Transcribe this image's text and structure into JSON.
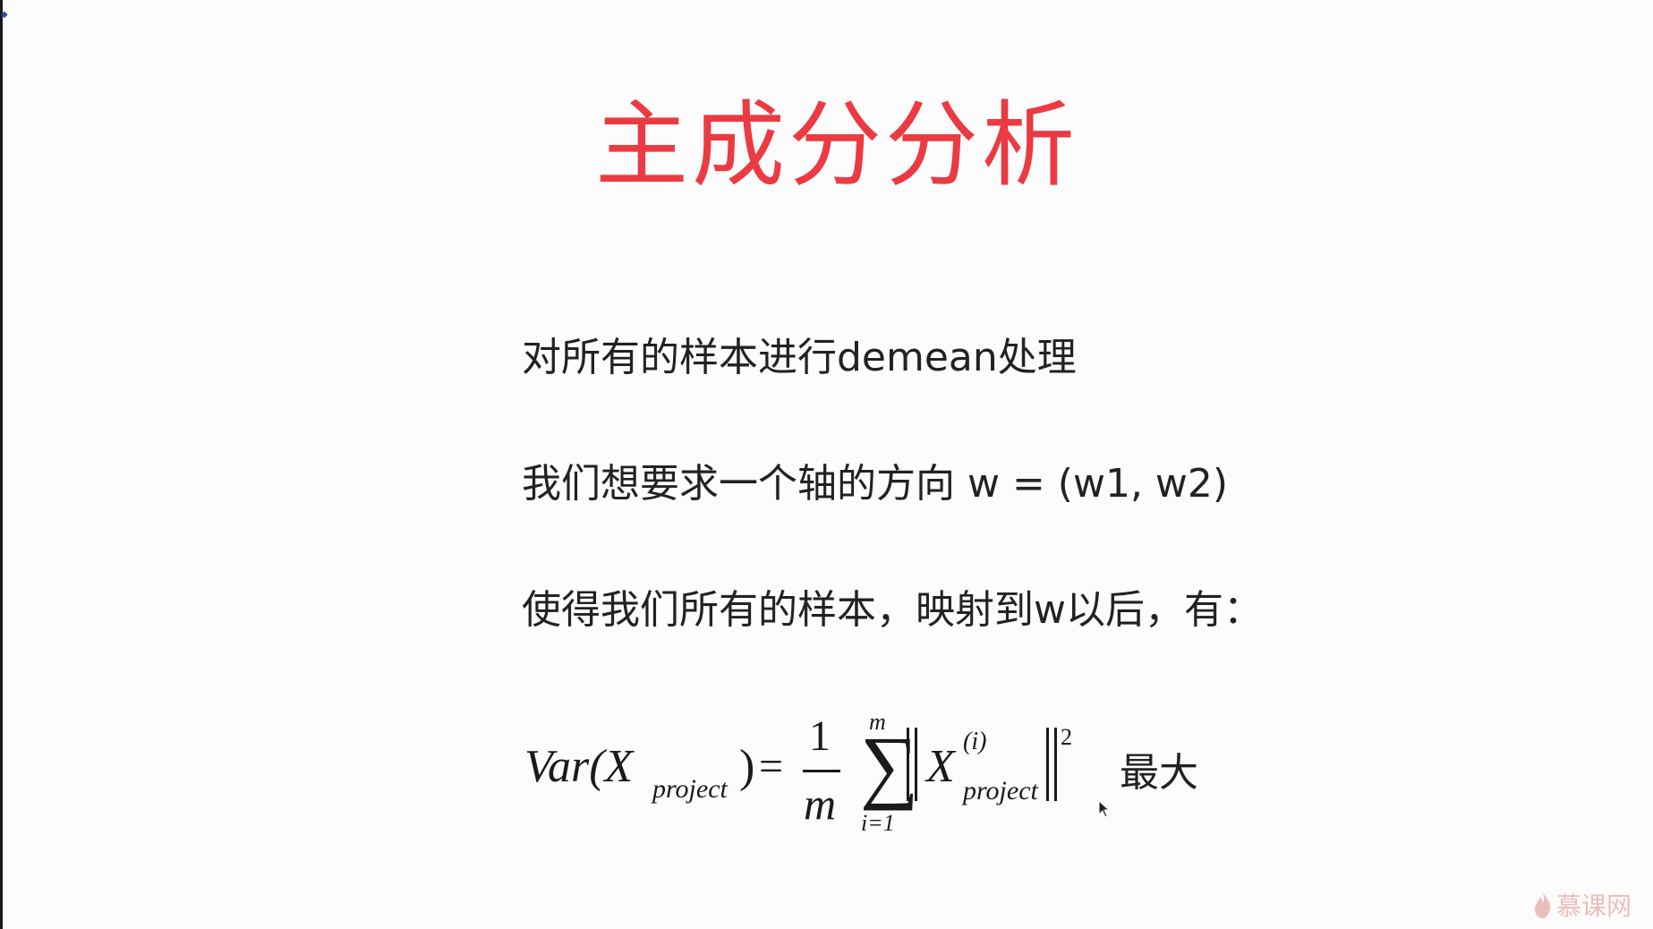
{
  "slide": {
    "title": "主成分分析",
    "lines": [
      "对所有的样本进行demean处理",
      "我们想要求一个轴的方向 w = (w1, w2)",
      "使得我们所有的样本，映射到w以后，有："
    ],
    "formula": {
      "lhs_var": "Var(X",
      "lhs_subscript": "project",
      "lhs_close": ")",
      "equals": "=",
      "fraction_numerator": "1",
      "fraction_denominator": "m",
      "sum_symbol": "∑",
      "sum_upper": "m",
      "sum_lower": "i=1",
      "term_X": "X",
      "term_superscript": "(i)",
      "term_subscript": "project",
      "exponent": "2",
      "suffix": "最大"
    }
  },
  "watermark": {
    "text": "慕课网",
    "color": "#e9b8b6"
  },
  "colors": {
    "title": "#ec3a43",
    "text": "#222222",
    "background": "#fdfcfc"
  },
  "icons": {
    "watermark_logo": "flame-icon",
    "pointer": "cursor-arrow-icon"
  }
}
